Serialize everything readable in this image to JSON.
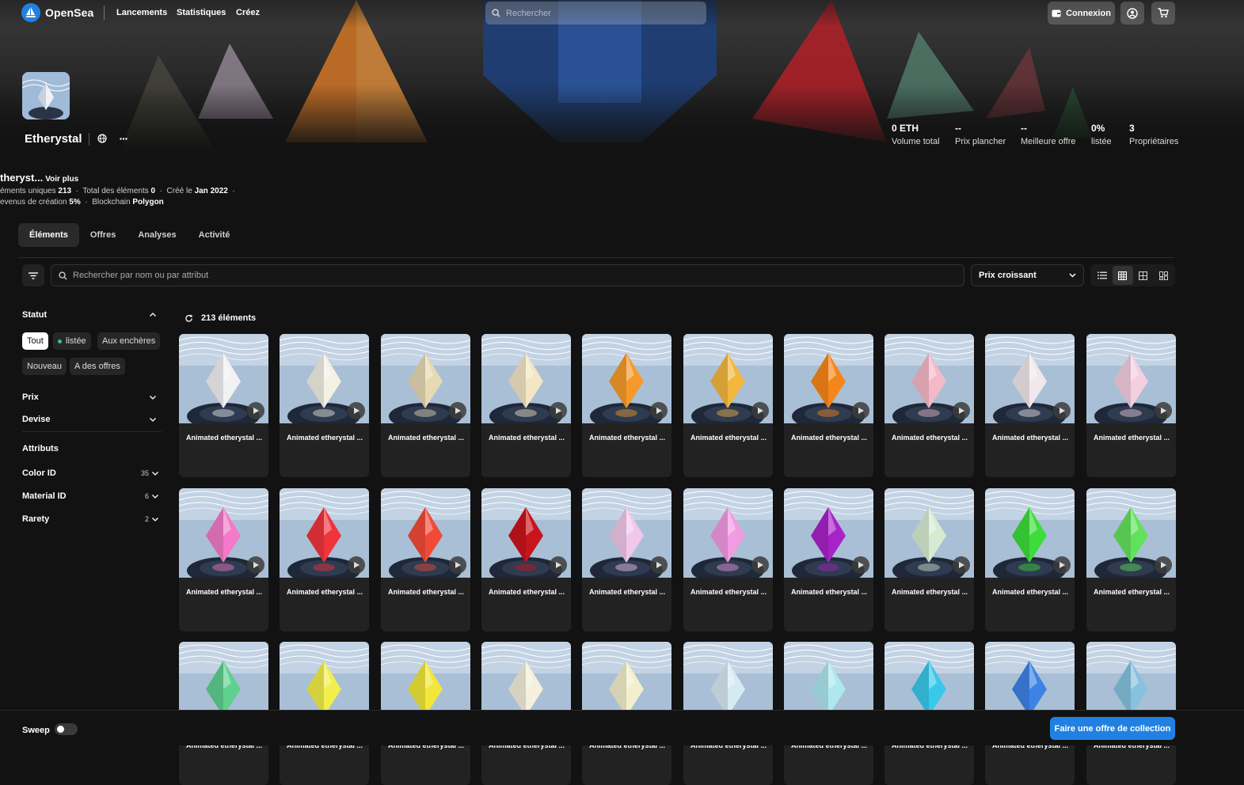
{
  "header": {
    "brand": "OpenSea",
    "nav": [
      "Lancements",
      "Statistiques",
      "Créez"
    ],
    "search_placeholder": "Rechercher",
    "connect_label": "Connexion"
  },
  "collection": {
    "name": "Etherystal",
    "stats": [
      {
        "value": "0 ETH",
        "label": "Volume total"
      },
      {
        "value": "--",
        "label": "Prix plancher"
      },
      {
        "value": "--",
        "label": "Meilleure offre"
      },
      {
        "value": "0%",
        "label": "listée"
      },
      {
        "value": "3",
        "label": "Propriétaires"
      }
    ],
    "description_truncated": "theryst...",
    "see_more": "Voir plus",
    "meta_line1": {
      "unique_label": "éments uniques",
      "unique_value": "213",
      "total_label": "Total des éléments",
      "total_value": "0",
      "created_label": "Créé le",
      "created_value": "Jan 2022"
    },
    "meta_line2": {
      "royalty_label": "evenus de création",
      "royalty_value": "5%",
      "chain_label": "Blockchain",
      "chain_value": "Polygon"
    }
  },
  "tabs": [
    {
      "label": "Éléments",
      "active": true
    },
    {
      "label": "Offres",
      "active": false
    },
    {
      "label": "Analyses",
      "active": false
    },
    {
      "label": "Activité",
      "active": false
    }
  ],
  "toolbar": {
    "search_placeholder": "Rechercher par nom ou par attribut",
    "sort_label": "Prix croissant"
  },
  "sidebar": {
    "status_title": "Statut",
    "status_chips": [
      "Tout",
      "listée",
      "Aux enchères",
      "Nouveau",
      "A des offres"
    ],
    "price_title": "Prix",
    "currency_title": "Devise",
    "attributes_title": "Attributs",
    "attributes": [
      {
        "name": "Color ID",
        "count": "35"
      },
      {
        "name": "Material ID",
        "count": "6"
      },
      {
        "name": "Rarety",
        "count": "2"
      }
    ]
  },
  "results": {
    "count_label": "213 éléments",
    "item_title": "Animated etherystal ...",
    "crystal_colors": [
      "#f2f2f4",
      "#f3f0e4",
      "#e6d9b4",
      "#f4e6c4",
      "#f59a2a",
      "#f3b740",
      "#f6861a",
      "#f4b9c8",
      "#f2e8ec",
      "#f3cfe0",
      "#f27ac8",
      "#f0343c",
      "#f24a38",
      "#c8141c",
      "#f1c8ea",
      "#f29ae2",
      "#a822c8",
      "#d6ecd2",
      "#3cdc3a",
      "#62e25c",
      "#5fd08e",
      "#f2ee4a",
      "#f2e63a",
      "#f4f0dc",
      "#f2f0cc",
      "#d6eaf2",
      "#aee8ee",
      "#38c8ea",
      "#3e82e6",
      "#86c2de"
    ]
  },
  "footer": {
    "sweep_label": "Sweep",
    "offer_button": "Faire une offre de collection"
  }
}
